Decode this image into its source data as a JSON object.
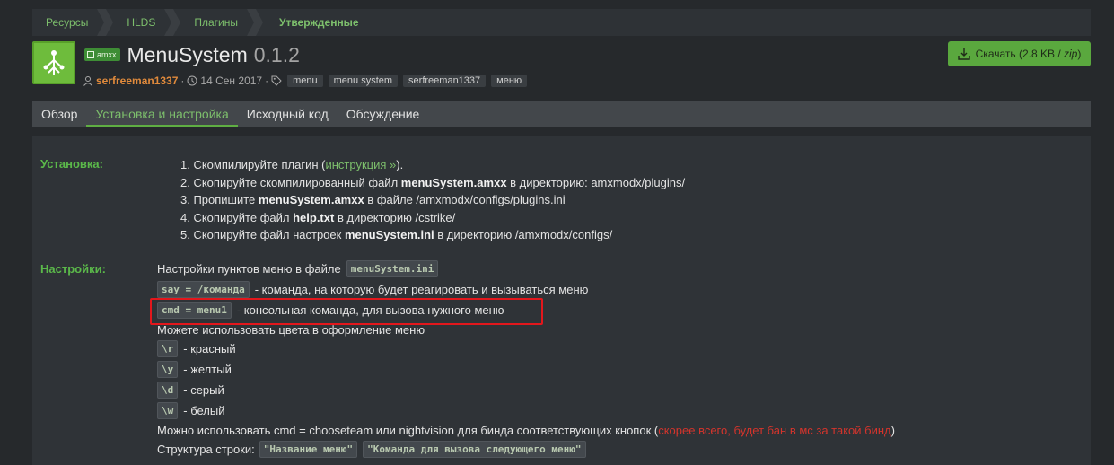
{
  "breadcrumb": [
    "Ресурсы",
    "HLDS",
    "Плагины",
    "Утвержденные"
  ],
  "header": {
    "prefix": "amxx",
    "title": "MenuSystem",
    "version": "0.1.2",
    "author": "serfreeman1337",
    "date": "14 Сен 2017",
    "tags": [
      "menu",
      "menu system",
      "serfreeman1337",
      "меню"
    ],
    "download_label": "Скачать (2.8 KB / ",
    "download_ext": "zip",
    "download_tail": ")"
  },
  "tabs": [
    "Обзор",
    "Установка и настройка",
    "Исходный код",
    "Обсуждение"
  ],
  "install": {
    "label": "Установка:",
    "step1_pre": "1. Скомпилируйте плагин (",
    "step1_link": "инструкция",
    "step1_post": ").",
    "step2_pre": "2. Скопируйте скомпилированный файл ",
    "step2_bold": "menuSystem.amxx",
    "step2_post": " в директорию: amxmodx/plugins/",
    "step3_pre": "3. Пропишите ",
    "step3_bold": "menuSystem.amxx",
    "step3_post": " в файле /amxmodx/configs/plugins.ini",
    "step4_pre": "4. Скопируйте файл ",
    "step4_bold": "help.txt",
    "step4_post": " в директорию /cstrike/",
    "step5_pre": "5. Скопируйте файл настроек ",
    "step5_bold": "menuSystem.ini",
    "step5_post": " в директорию /amxmodx/configs/"
  },
  "settings": {
    "label": "Настройки:",
    "intro": "Настройки пунктов меню в файле",
    "intro_code": "menuSystem.ini",
    "say_code": "say = /команда",
    "say_text": "- команда, на которую будет реагировать и вызываться меню",
    "cmd_code": "cmd = menu1",
    "cmd_text": "- консольная команда, для вызова нужного меню",
    "colors_intro": "Можете использовать цвета в оформление меню",
    "colors": [
      {
        "code": "\\r",
        "text": "- красный"
      },
      {
        "code": "\\y",
        "text": "- желтый"
      },
      {
        "code": "\\d",
        "text": "- серый"
      },
      {
        "code": "\\w",
        "text": "- белый"
      }
    ],
    "bind_pre": "Можно использовать cmd = chooseteam или nightvision для бинда соответствующих кнопок (",
    "bind_red": "скорее всего, будет бан в мс за такой бинд",
    "bind_post": ")",
    "structure_label": "Структура строки:",
    "structure_code1": "\"Название меню\"",
    "structure_code2": "\"Команда для вызова следующего меню\""
  }
}
